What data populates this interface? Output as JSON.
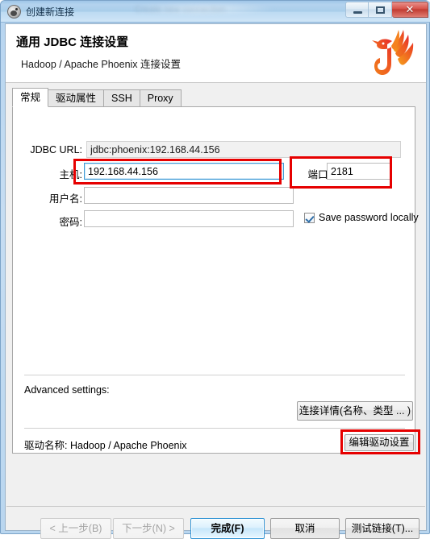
{
  "window": {
    "title": "创建新连接",
    "icon": "beaver-icon",
    "ghost_text": "Create new connection",
    "controls": {
      "minimize": "minimize-icon",
      "maximize": "maximize-icon",
      "close": "✕"
    }
  },
  "header": {
    "title": "通用 JDBC 连接设置",
    "subtitle": "Hadoop / Apache Phoenix 连接设置",
    "logo": "apache-phoenix-logo"
  },
  "tabs": [
    {
      "label": "常规",
      "active": true
    },
    {
      "label": "驱动属性",
      "active": false
    },
    {
      "label": "SSH",
      "active": false
    },
    {
      "label": "Proxy",
      "active": false
    }
  ],
  "form": {
    "jdbc_url": {
      "label": "JDBC URL:",
      "value": "jdbc:phoenix:192.168.44.156",
      "placeholder": ""
    },
    "host": {
      "label": "主机:",
      "value": "192.168.44.156",
      "placeholder": ""
    },
    "port": {
      "label": "端口:",
      "value": "2181",
      "placeholder": ""
    },
    "username": {
      "label": "用户名:",
      "value": "",
      "placeholder": ""
    },
    "password": {
      "label": "密码:",
      "value": "",
      "placeholder": ""
    },
    "save_password": {
      "label": "Save password locally",
      "checked": true
    }
  },
  "advanced": {
    "label": "Advanced settings:",
    "detail_button": "连接详情(名称、类型 ... )"
  },
  "driver": {
    "label": "驱动名称:",
    "name": "Hadoop / Apache Phoenix",
    "edit_button": "编辑驱动设置"
  },
  "footer": {
    "prev": "< 上一步(B)",
    "next": "下一步(N) >",
    "finish": "完成(F)",
    "cancel": "取消",
    "test": "测试链接(T)..."
  },
  "colors": {
    "accent": "#2f93d4",
    "annotation": "#e60000",
    "dialog_bg": "#f0f0f0",
    "phoenix_orange": "#f5821f",
    "phoenix_red": "#e8332a"
  }
}
